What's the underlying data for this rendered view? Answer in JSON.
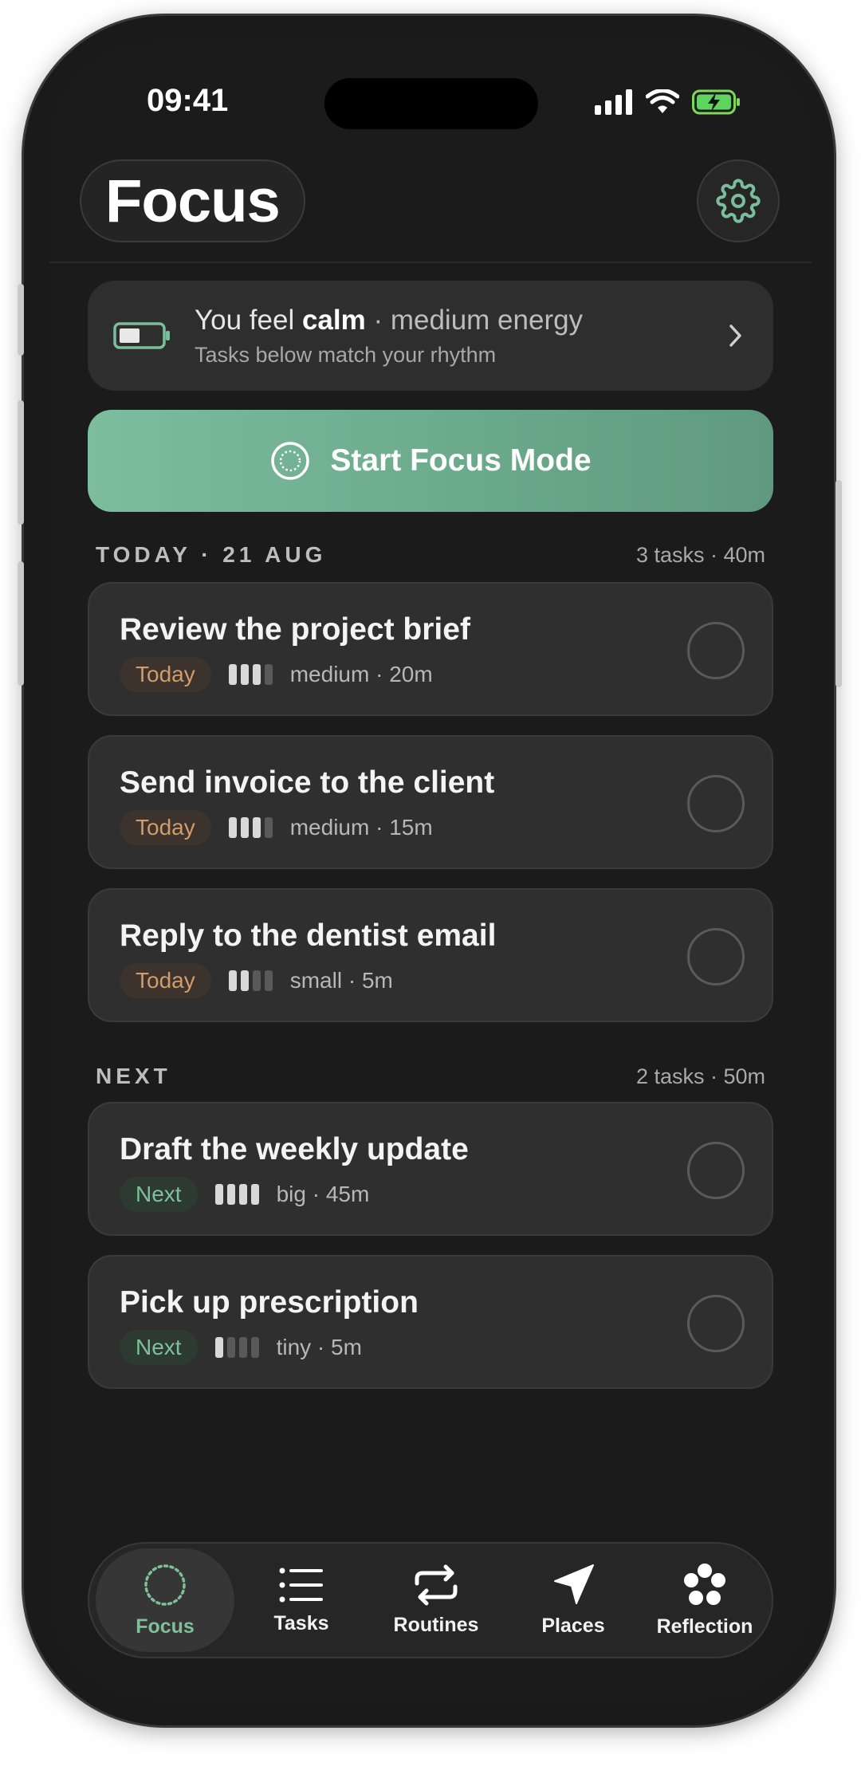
{
  "status_bar": {
    "time": "09:41"
  },
  "header": {
    "title": "Focus"
  },
  "mood": {
    "prefix": "You feel ",
    "feeling": "calm",
    "energy": " · medium energy",
    "subtitle": "Tasks below match your rhythm",
    "battery_level": 0.5
  },
  "focus_button": {
    "label": "Start Focus Mode"
  },
  "sections": [
    {
      "name": "TODAY · 21 AUG",
      "meta": "3 tasks · 40m"
    },
    {
      "name": "NEXT",
      "meta": "2 tasks · 50m"
    }
  ],
  "tasks": [
    {
      "title": "Review the project brief",
      "badge": "Today",
      "size_level": 3,
      "detail": "medium · 20m"
    },
    {
      "title": "Send invoice to the client",
      "badge": "Today",
      "size_level": 3,
      "detail": "medium · 15m"
    },
    {
      "title": "Reply to the dentist email",
      "badge": "Today",
      "size_level": 2,
      "detail": "small · 5m"
    },
    {
      "title": "Draft the weekly update",
      "badge": "Next",
      "size_level": 4,
      "detail": "big · 45m"
    },
    {
      "title": "Pick up prescription",
      "badge": "Next",
      "size_level": 1,
      "detail": "tiny · 5m"
    }
  ],
  "tabs": [
    {
      "label": "Focus",
      "icon": "focus-ring-icon",
      "active": true
    },
    {
      "label": "Tasks",
      "icon": "list-icon",
      "active": false
    },
    {
      "label": "Routines",
      "icon": "repeat-icon",
      "active": false
    },
    {
      "label": "Places",
      "icon": "navigation-arrow-icon",
      "active": false
    },
    {
      "label": "Reflection",
      "icon": "flower-icon",
      "active": false
    }
  ],
  "colors": {
    "accent": "#7cbd9d",
    "today_badge": "#d39b6a",
    "next_badge": "#7fc09a",
    "background": "#1b1b1b"
  }
}
